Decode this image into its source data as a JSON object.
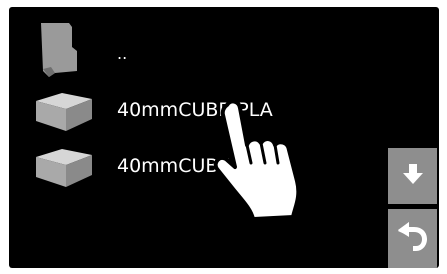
{
  "file_list": {
    "items": [
      {
        "label": "..",
        "icon": "folder-up-icon"
      },
      {
        "label": "40mmCUBE-PLA",
        "icon": "cube-icon"
      },
      {
        "label": "40mmCUBE-PLA",
        "icon": "cube-icon"
      }
    ]
  },
  "controls": {
    "scroll_down_icon": "arrow-down-icon",
    "back_icon": "back-arrow-icon"
  },
  "overlay": {
    "icon": "touch-hand-icon"
  },
  "colors": {
    "background": "#000000",
    "button": "#8e8e8e",
    "text": "#ffffff",
    "icon_gray": "#9a9a9a"
  }
}
